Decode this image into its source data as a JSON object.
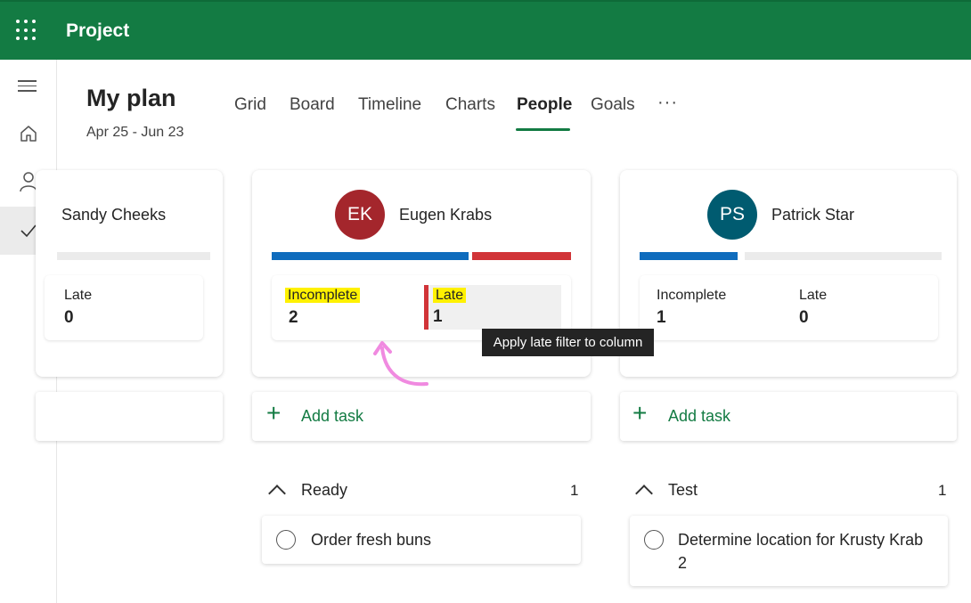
{
  "app": {
    "title": "Project"
  },
  "plan": {
    "title": "My plan",
    "dates": "Apr 25 - Jun 23"
  },
  "tabs": [
    {
      "label": "Grid"
    },
    {
      "label": "Board"
    },
    {
      "label": "Timeline"
    },
    {
      "label": "Charts"
    },
    {
      "label": "People",
      "active": true
    },
    {
      "label": "Goals"
    }
  ],
  "more_label": "···",
  "people": [
    {
      "name": "Sandy Cheeks",
      "stats": {
        "late_label": "Late",
        "late_value": "0"
      }
    },
    {
      "name": "Eugen Krabs",
      "initials": "EK",
      "color": "#a4262c",
      "stats": {
        "incomplete_label": "Incomplete",
        "incomplete_value": "2",
        "late_label": "Late",
        "late_value": "1"
      }
    },
    {
      "name": "Patrick Star",
      "initials": "PS",
      "color": "#005b70",
      "stats": {
        "incomplete_label": "Incomplete",
        "incomplete_value": "1",
        "late_label": "Late",
        "late_value": "0"
      }
    }
  ],
  "add_task_label": "Add task",
  "buckets": [
    {
      "title": "Ready",
      "count": "1",
      "tasks": [
        {
          "title": "Order fresh buns"
        }
      ]
    },
    {
      "title": "Test",
      "count": "1",
      "tasks": [
        {
          "title": "Determine location for Krusty Krab 2"
        }
      ]
    }
  ],
  "tooltip": "Apply late filter to column",
  "colors": {
    "brand": "#137b43",
    "progress_blue": "#0f6cbd",
    "late_red": "#d13438",
    "highlight": "#fff100",
    "annotation": "#f08ae0"
  },
  "icons": [
    "waffle-icon",
    "hamburger-icon",
    "home-icon",
    "person-icon",
    "check-icon",
    "plus-icon",
    "chevron-up-icon",
    "radio-circle-icon"
  ]
}
